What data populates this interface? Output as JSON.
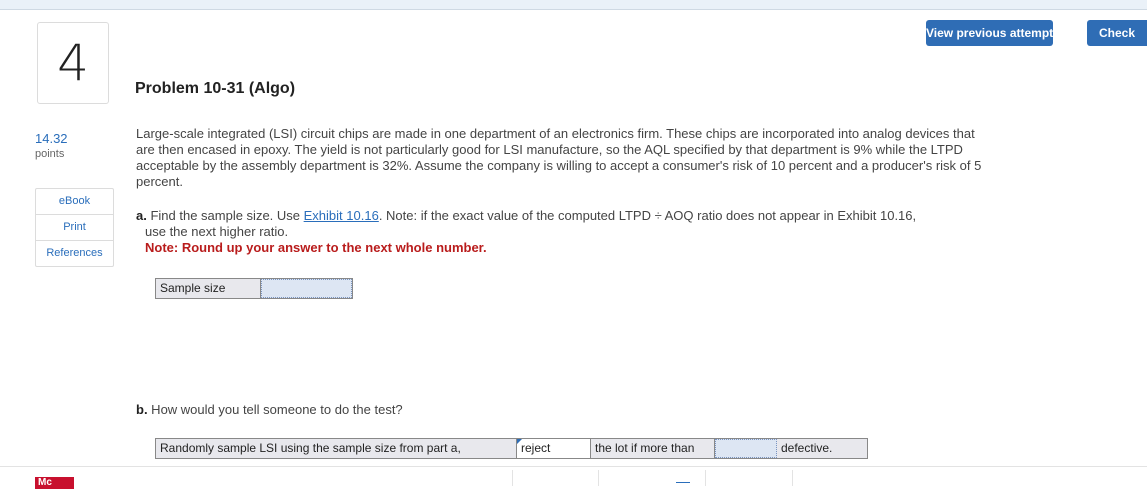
{
  "question": {
    "number": "4",
    "points_value": "14.32",
    "points_label": "points"
  },
  "side_buttons": [
    "eBook",
    "Print",
    "References"
  ],
  "header": {
    "view_previous_label": "View previous attempt",
    "check_label": "Check"
  },
  "problem": {
    "title": "Problem 10-31 (Algo)",
    "statement": "Large-scale integrated (LSI) circuit chips are made in one department of an electronics firm. These chips are incorporated into analog devices that are then encased in epoxy. The yield is not particularly good for LSI manufacture, so the AQL specified by that department is 9% while the LTPD acceptable by the assembly department is 32%. Assume the company is willing to accept a consumer's risk of 10 percent and a producer's risk of 5 percent."
  },
  "part_a": {
    "letter": "a.",
    "text_before_link": " Find the sample size. Use ",
    "link_text": "Exhibit 10.16",
    "text_after_link": ". Note: if the exact value of the computed LTPD ÷ AOQ ratio does not appear in Exhibit 10.16,",
    "text_line2": "use the next higher ratio.",
    "note": "Note: Round up your answer to the next whole number.",
    "table_label": "Sample size",
    "answer_value": ""
  },
  "part_b": {
    "letter": "b.",
    "question": " How would you tell someone to do the test?",
    "cell1": "Randomly sample LSI using the sample size from part a,",
    "select_value": "reject",
    "cell3": "the lot if more than",
    "answer_value": "",
    "cell5": "defective."
  },
  "footer": {
    "logo_text": "Mc"
  },
  "colors": {
    "accent": "#2f6db5",
    "note_red": "#b91c1c",
    "link": "#2a6ebb"
  }
}
